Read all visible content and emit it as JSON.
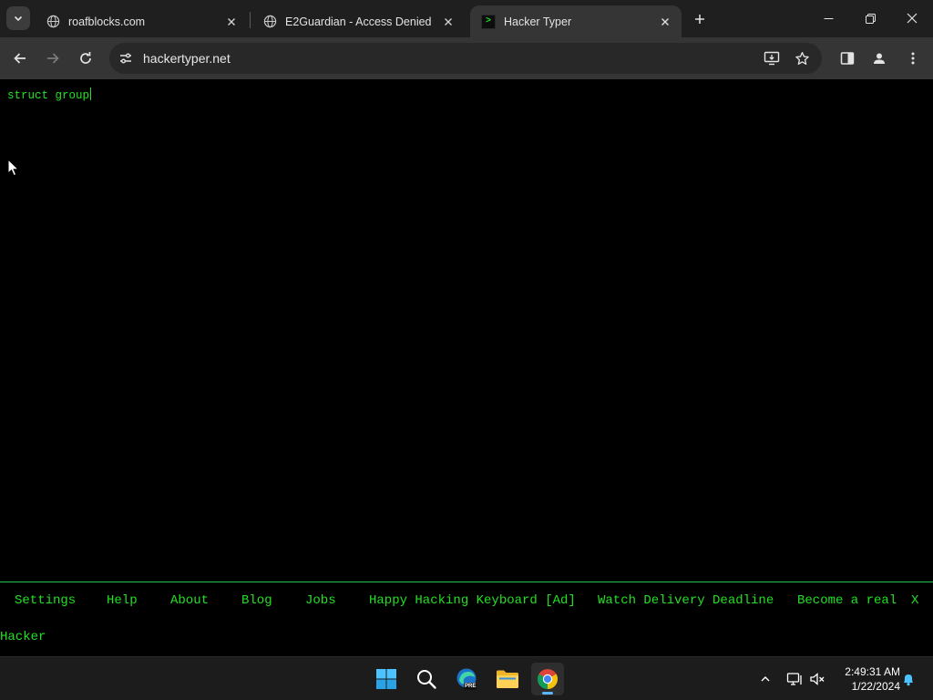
{
  "browser": {
    "tabs": [
      {
        "title": "roafblocks.com",
        "active": false
      },
      {
        "title": "E2Guardian - Access Denied",
        "active": false
      },
      {
        "title": "Hacker Typer",
        "active": true
      }
    ],
    "favicon_prompt": ">",
    "url": "hackertyper.net"
  },
  "page": {
    "console_text": "struct group",
    "menu": [
      "Settings",
      "Help",
      "About",
      "Blog",
      "Jobs",
      "Happy Hacking Keyboard [Ad]",
      "Watch Delivery Deadline",
      "Become a real",
      "X"
    ],
    "menu_wrap_text": "Hacker",
    "accent_color": "#22e022"
  },
  "taskbar": {
    "time": "2:49:31 AM",
    "date": "1/22/2024",
    "edge_badge": "PRE"
  }
}
